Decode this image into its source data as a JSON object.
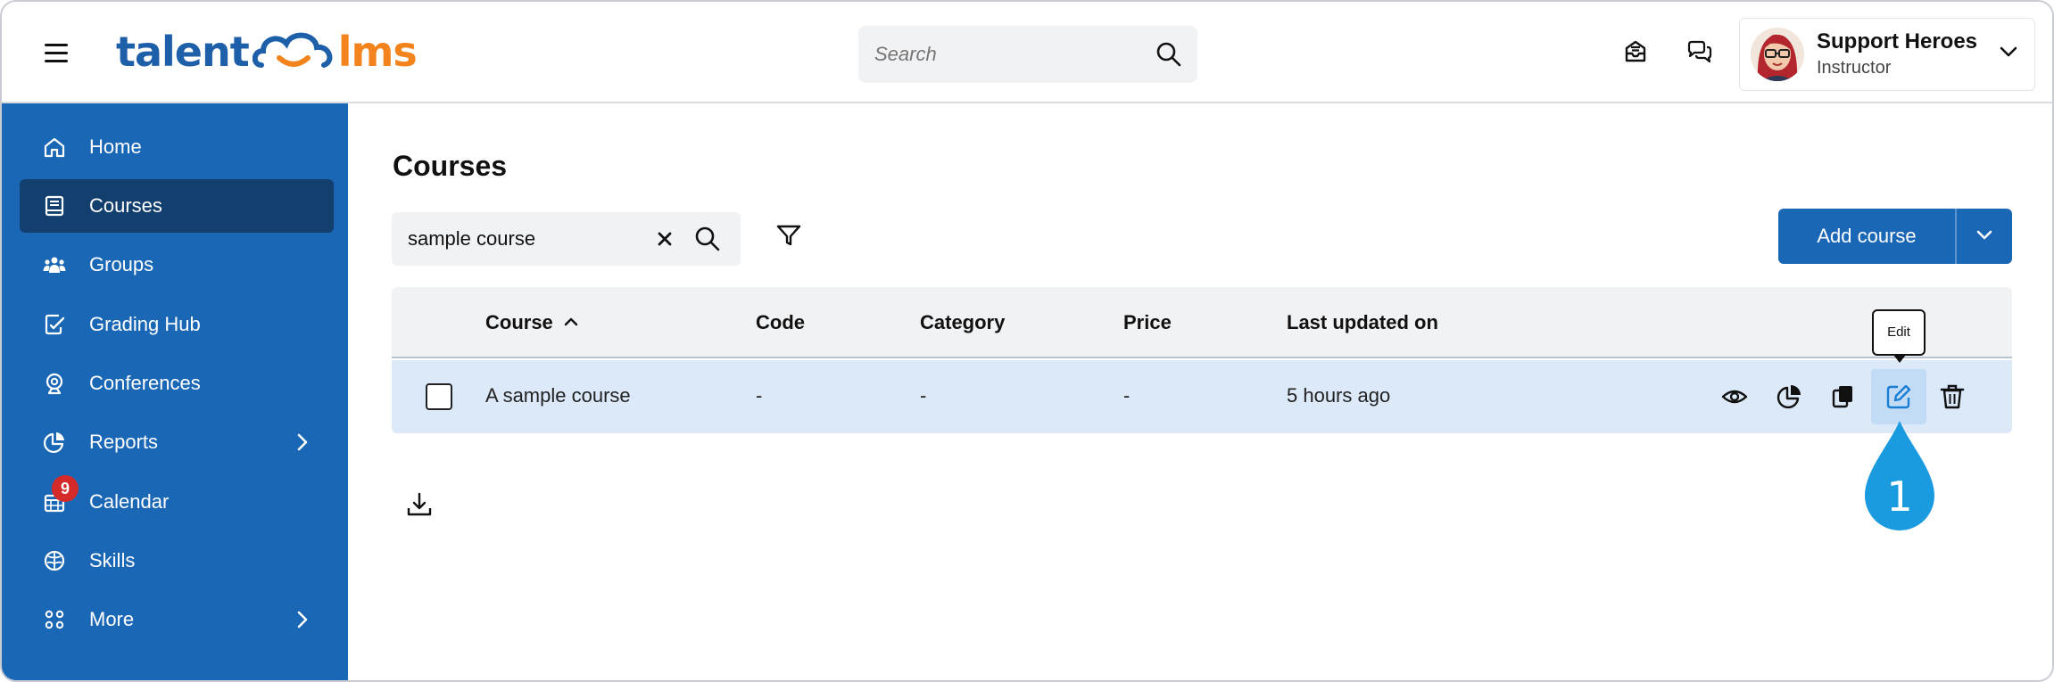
{
  "header": {
    "logo": {
      "part1": "talent",
      "part2": "lms"
    },
    "search": {
      "placeholder": "Search"
    },
    "user": {
      "name": "Support Heroes",
      "role": "Instructor"
    }
  },
  "sidebar": {
    "items": [
      {
        "label": "Home",
        "icon": "home-icon"
      },
      {
        "label": "Courses",
        "icon": "book-icon",
        "active": true
      },
      {
        "label": "Groups",
        "icon": "groups-icon"
      },
      {
        "label": "Grading Hub",
        "icon": "grading-icon"
      },
      {
        "label": "Conferences",
        "icon": "webcam-icon"
      },
      {
        "label": "Reports",
        "icon": "pie-chart-icon",
        "has_submenu": true
      },
      {
        "label": "Calendar",
        "icon": "calendar-icon",
        "badge": "9"
      },
      {
        "label": "Skills",
        "icon": "brain-icon"
      },
      {
        "label": "More",
        "icon": "grid-icon",
        "has_submenu": true
      }
    ]
  },
  "main": {
    "title": "Courses",
    "search": {
      "value": "sample course"
    },
    "add_course_label": "Add course",
    "table": {
      "headers": [
        "Course",
        "Code",
        "Category",
        "Price",
        "Last updated on"
      ],
      "rows": [
        {
          "course": "A sample course",
          "code": "-",
          "category": "-",
          "price": "-",
          "updated": "5 hours ago"
        }
      ],
      "row_actions": [
        "preview-icon",
        "reports-icon",
        "clone-icon",
        "edit-icon",
        "delete-icon"
      ]
    },
    "tooltip": "Edit",
    "callout_number": "1"
  },
  "colors": {
    "sidebar": "#1a67b5",
    "sidebar_active": "#123f6d",
    "logo_blue": "#1d5fa8",
    "logo_orange": "#f3841d",
    "row_selected": "#dce9f8",
    "callout": "#1a9be0",
    "badge": "#d42a2a"
  }
}
